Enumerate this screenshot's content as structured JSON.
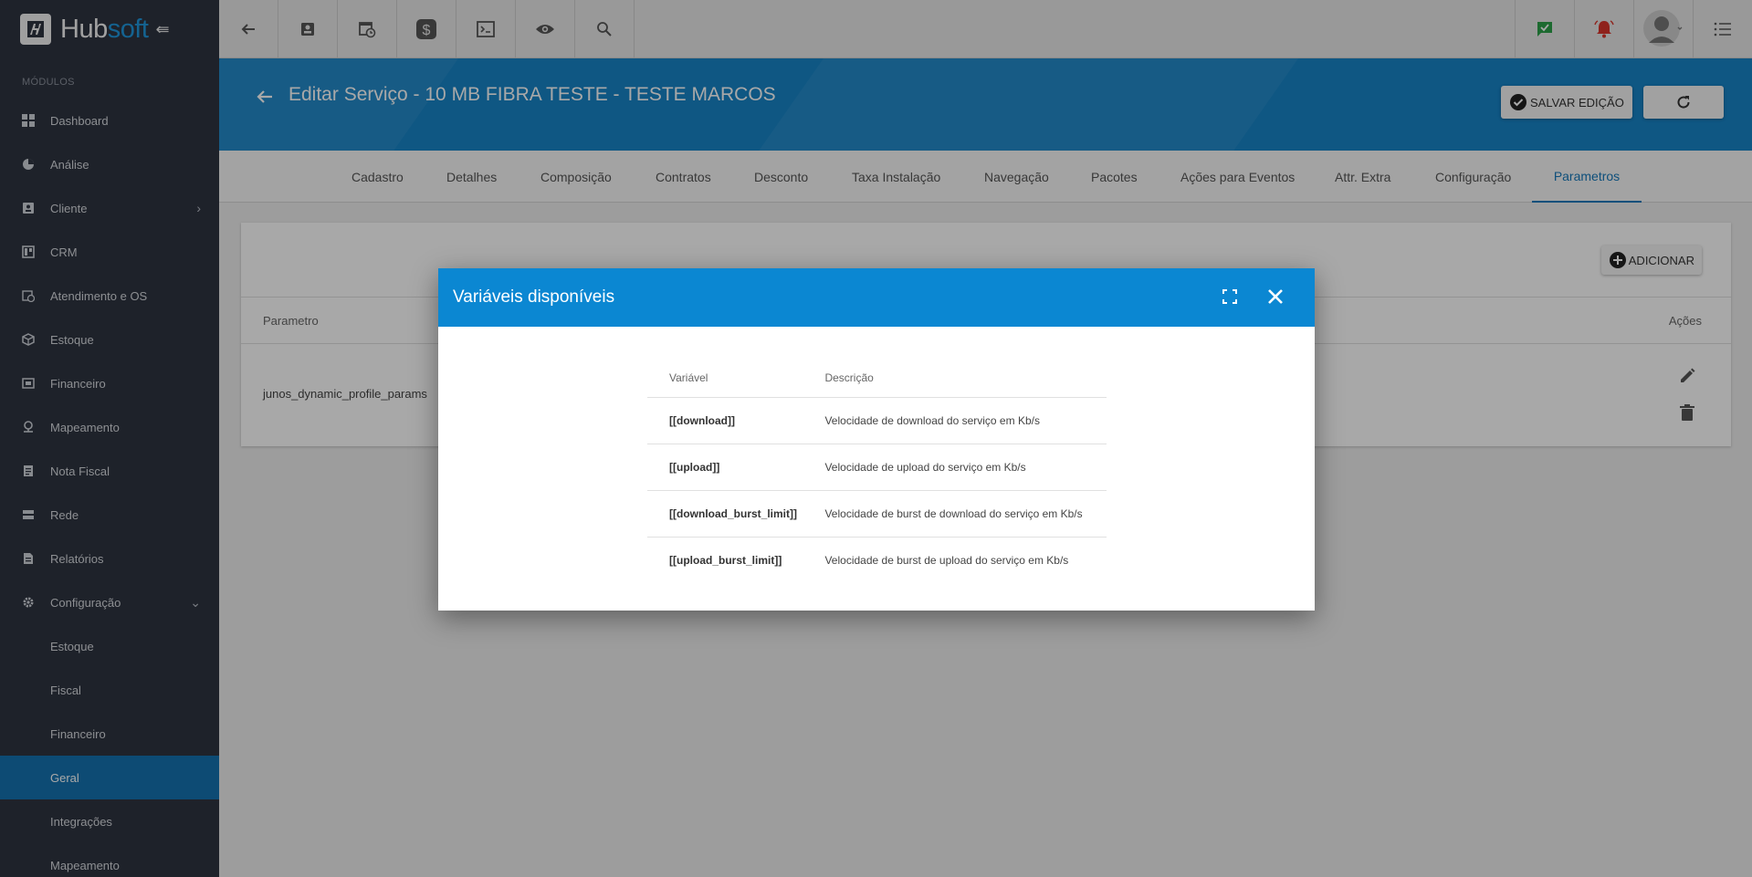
{
  "app": {
    "logo_main": "Hub",
    "logo_accent": "soft"
  },
  "sidebar": {
    "section_title": "MÓDULOS",
    "items": [
      {
        "label": "Dashboard",
        "icon": "dashboard-icon"
      },
      {
        "label": "Análise",
        "icon": "pie-chart-icon"
      },
      {
        "label": "Cliente",
        "icon": "contact-card-icon"
      },
      {
        "label": "CRM",
        "icon": "board-icon"
      },
      {
        "label": "Atendimento e OS",
        "icon": "calendar-clock-icon"
      },
      {
        "label": "Estoque",
        "icon": "package-icon"
      },
      {
        "label": "Financeiro",
        "icon": "money-icon"
      },
      {
        "label": "Mapeamento",
        "icon": "map-pin-icon"
      },
      {
        "label": "Nota Fiscal",
        "icon": "receipt-icon"
      },
      {
        "label": "Rede",
        "icon": "server-icon"
      },
      {
        "label": "Relatórios",
        "icon": "document-icon"
      },
      {
        "label": "Configuração",
        "icon": "gear-icon"
      }
    ],
    "sub_items": [
      {
        "label": "Estoque"
      },
      {
        "label": "Fiscal"
      },
      {
        "label": "Financeiro"
      },
      {
        "label": "Geral",
        "active": true
      },
      {
        "label": "Integrações"
      },
      {
        "label": "Mapeamento"
      }
    ]
  },
  "header": {
    "title": "Editar Serviço - 10 MB FIBRA TESTE - TESTE MARCOS",
    "save_label": "SALVAR EDIÇÃO"
  },
  "tabs": [
    {
      "label": "Cadastro"
    },
    {
      "label": "Detalhes"
    },
    {
      "label": "Composição"
    },
    {
      "label": "Contratos"
    },
    {
      "label": "Desconto"
    },
    {
      "label": "Taxa Instalação"
    },
    {
      "label": "Navegação"
    },
    {
      "label": "Pacotes"
    },
    {
      "label": "Ações para Eventos"
    },
    {
      "label": "Attr. Extra"
    },
    {
      "label": "Configuração"
    },
    {
      "label": "Parametros",
      "active": true
    }
  ],
  "card": {
    "add_label": "ADICIONAR",
    "col_param": "Parametro",
    "col_actions": "Ações",
    "row_param": "junos_dynamic_profile_params"
  },
  "modal": {
    "title": "Variáveis disponíveis",
    "col_var": "Variável",
    "col_desc": "Descrição",
    "rows": [
      {
        "var": "[[download]]",
        "desc": "Velocidade de download do serviço em Kb/s"
      },
      {
        "var": "[[upload]]",
        "desc": "Velocidade de upload do serviço em Kb/s"
      },
      {
        "var": "[[download_burst_limit]]",
        "desc": "Velocidade de burst de download do serviço em Kb/s"
      },
      {
        "var": "[[upload_burst_limit]]",
        "desc": "Velocidade de burst de upload do serviço em Kb/s"
      }
    ]
  },
  "colors": {
    "sidebar_bg": "#2e3441",
    "header_bg": "#1784c7",
    "modal_header_bg": "#0b87d2",
    "active_item_bg": "#1473b0",
    "chat_icon_color": "#2ca24a",
    "bell_icon_color": "#d9352b"
  }
}
